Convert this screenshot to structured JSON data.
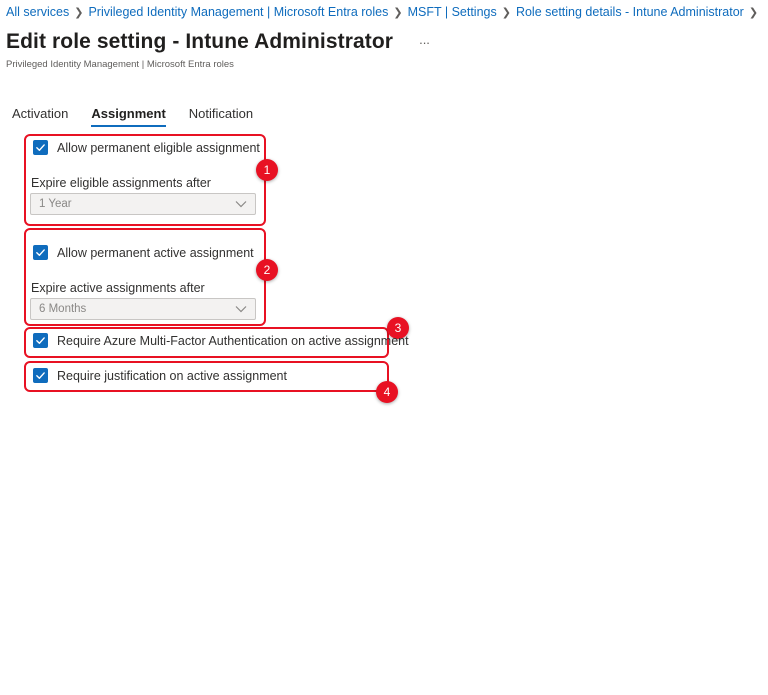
{
  "breadcrumb": {
    "items": [
      "All services",
      "Privileged Identity Management | Microsoft Entra roles",
      "MSFT | Settings",
      "Role setting details - Intune Administrator"
    ]
  },
  "header": {
    "title": "Edit role setting - Intune Administrator",
    "more": "...",
    "subtitle": "Privileged Identity Management | Microsoft Entra roles"
  },
  "tabs": [
    {
      "label": "Activation",
      "active": false
    },
    {
      "label": "Assignment",
      "active": true
    },
    {
      "label": "Notification",
      "active": false
    }
  ],
  "settings": {
    "eligible": {
      "checkbox_label": "Allow permanent eligible assignment",
      "checked": true,
      "expire_label": "Expire eligible assignments after",
      "expire_value": "1 Year",
      "badge": "1"
    },
    "active": {
      "checkbox_label": "Allow permanent active assignment",
      "checked": true,
      "expire_label": "Expire active assignments after",
      "expire_value": "6 Months",
      "badge": "2"
    },
    "mfa": {
      "checkbox_label": "Require Azure Multi-Factor Authentication on active assignment",
      "checked": true,
      "badge": "3"
    },
    "justification": {
      "checkbox_label": "Require justification on active assignment",
      "checked": true,
      "badge": "4"
    }
  },
  "colors": {
    "accent": "#0f6cbd",
    "highlight": "#e81123"
  },
  "icons": {
    "separator": "chevron-right-icon",
    "checkbox": "checkmark-icon",
    "dropdown": "chevron-down-icon",
    "more": "more-icon"
  }
}
